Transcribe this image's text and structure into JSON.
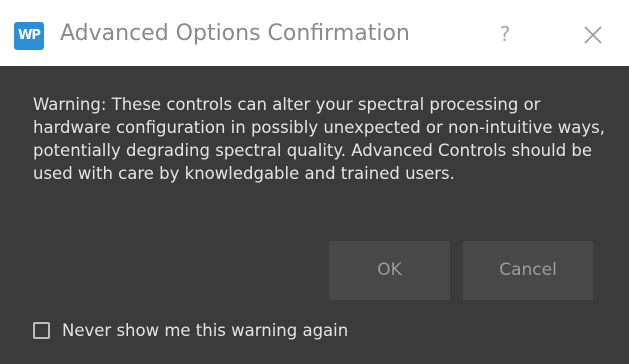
{
  "window": {
    "title": "Advanced Options Confirmation",
    "app_icon_text": "WP",
    "help_label": "?",
    "close_icon": "close-icon"
  },
  "message": {
    "text": "Warning: These controls can alter your spectral processing or hardware configuration in possibly unexpected or non-intuitive ways, potentially degrading spectral quality. Advanced Controls should be used with care by knowledgable and trained users."
  },
  "buttons": {
    "ok_label": "OK",
    "cancel_label": "Cancel"
  },
  "checkbox": {
    "label": "Never show me this warning again",
    "checked": false
  },
  "colors": {
    "background": "#3b3b3b",
    "titlebar": "#ffffff",
    "app_icon": "#2d8fd8",
    "text": "#e4e4e4",
    "button": "#484848"
  }
}
